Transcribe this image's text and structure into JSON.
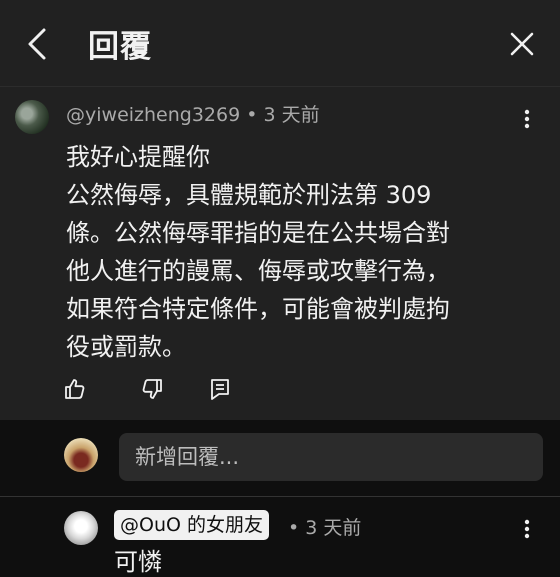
{
  "header": {
    "title": "回覆"
  },
  "comment": {
    "author": "@yiweizheng3269",
    "separator": "•",
    "time": "3 天前",
    "lines": [
      "我好心提醒你",
      "公然侮辱，具體規範於刑法第 309",
      "條。公然侮辱罪指的是在公共場合對",
      "他人進行的謾罵、侮辱或攻擊行為，",
      "如果符合特定條件，可能會被判處拘",
      "役或罰款。"
    ]
  },
  "reply_box": {
    "placeholder": "新增回覆..."
  },
  "reply": {
    "mention": "@OuO 的女朋友",
    "separator": "•",
    "time": "3 天前",
    "text": "可憐"
  }
}
